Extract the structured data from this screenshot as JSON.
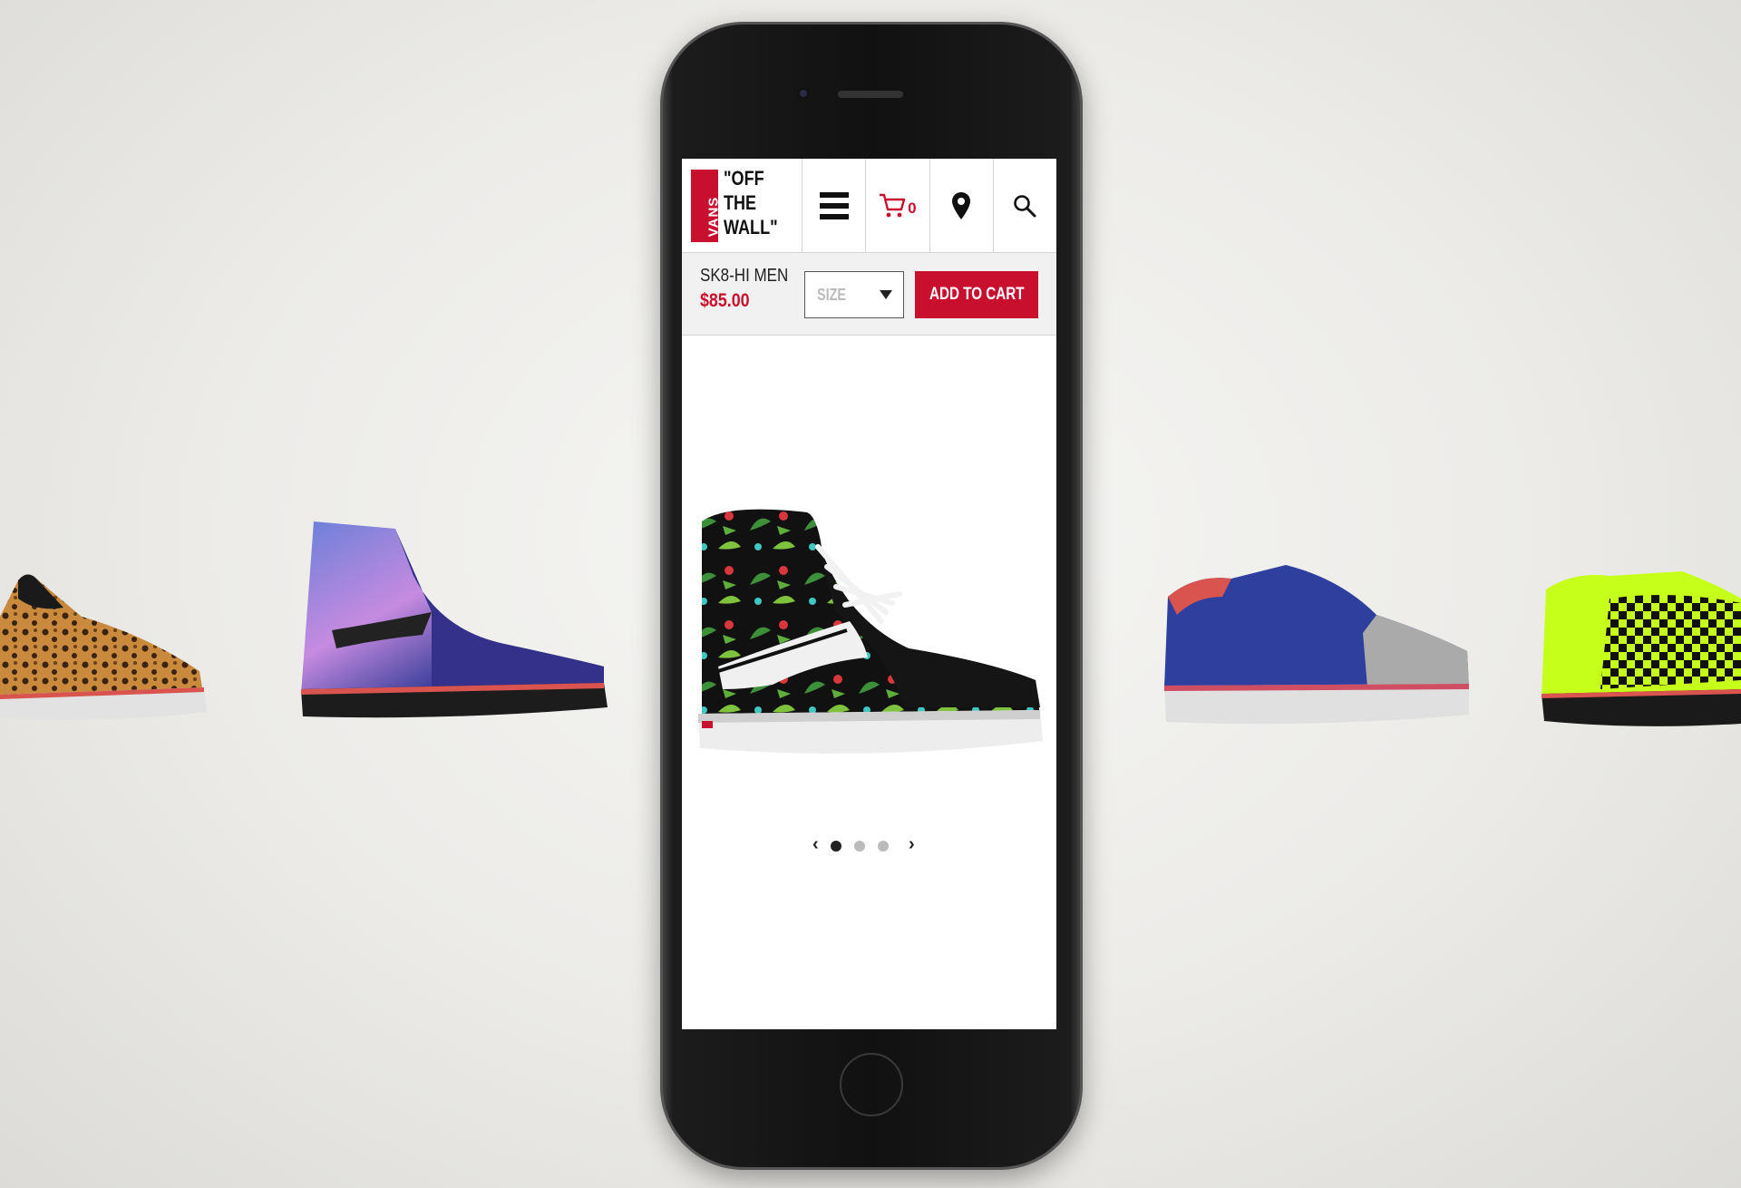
{
  "header": {
    "logo": {
      "brand": "VANS",
      "slogan_lines": [
        "\"OFF",
        "THE",
        "WALL\""
      ]
    },
    "menu_icon": "hamburger-menu-icon",
    "cart": {
      "icon": "cart-icon",
      "count": "0"
    },
    "location_icon": "map-pin-icon",
    "search_icon": "search-icon"
  },
  "product": {
    "name": "SK8-HI MEN",
    "price": "$85.00",
    "size_select": {
      "placeholder": "SIZE"
    },
    "add_to_cart_label": "ADD TO CART"
  },
  "carousel": {
    "total_slides": 3,
    "active_slide": 1
  },
  "colors": {
    "accent": "#c8102e",
    "phone_body": "#111111",
    "background": "#ecebe8"
  }
}
